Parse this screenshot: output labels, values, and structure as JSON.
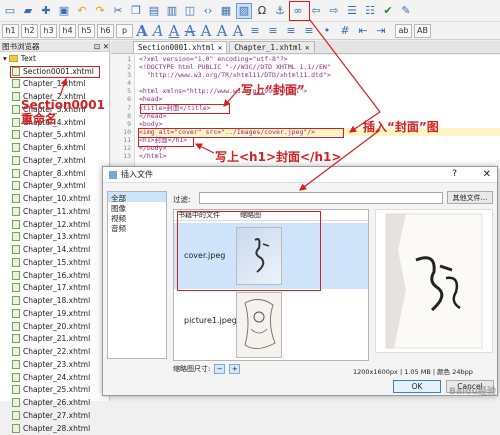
{
  "toolbar": {
    "icons": [
      "new-file",
      "open-folder",
      "add-file",
      "save",
      "undo",
      "redo",
      "cut",
      "copy",
      "paste",
      "paste-special",
      "book-view",
      "code-view",
      "insert-image",
      "omega",
      "anchor",
      "link",
      "spellcheck",
      "tidy"
    ],
    "headings": [
      "h1",
      "h2",
      "h3",
      "h4",
      "h5",
      "h6",
      "p"
    ],
    "format_glyphs": [
      "A",
      "A",
      "A",
      "A",
      "A",
      "A",
      "A"
    ],
    "right_labels": [
      "ab",
      "AB"
    ]
  },
  "browser": {
    "title": "图书浏览器",
    "pin": "⊡ ✕",
    "folder": "Text",
    "items": [
      "Section0001.xhtml",
      "Chapter_1.xhtml",
      "Chapter_2.xhtml",
      "Chapter_3.xhtml",
      "Chapter_4.xhtml",
      "Chapter_5.xhtml",
      "Chapter_6.xhtml",
      "Chapter_7.xhtml",
      "Chapter_8.xhtml",
      "Chapter_9.xhtml",
      "Chapter_10.xhtml",
      "Chapter_11.xhtml",
      "Chapter_12.xhtml",
      "Chapter_13.xhtml",
      "Chapter_14.xhtml",
      "Chapter_15.xhtml",
      "Chapter_16.xhtml",
      "Chapter_17.xhtml",
      "Chapter_18.xhtml",
      "Chapter_19.xhtml",
      "Chapter_20.xhtml",
      "Chapter_21.xhtml",
      "Chapter_22.xhtml",
      "Chapter_23.xhtml",
      "Chapter_24.xhtml",
      "Chapter_25.xhtml",
      "Chapter_26.xhtml",
      "Chapter_27.xhtml",
      "Chapter_28.xhtml"
    ]
  },
  "tabs": [
    {
      "label": "Section0001.xhtml",
      "close": "✕"
    },
    {
      "label": "Chapter_1.xhtml",
      "close": "✕"
    }
  ],
  "editor": {
    "lines": [
      "<?xml version=\"1.0\" encoding=\"utf-8\"?>",
      "<!DOCTYPE html PUBLIC \"-//W3C//DTD XHTML 1.1//EN\"",
      "  \"http://www.w3.org/TR/xhtml11/DTD/xhtml11.dtd\">",
      "",
      "<html xmlns=\"http://www.w3.org/1999/xhtml\">",
      "<head>",
      "<title>封面</title>",
      "</head>",
      "<body>",
      "<img alt=\"cover\" src=\"../Images/cover.jpeg\"/>",
      "<h1>封面</h1>",
      "</body>",
      "</html>"
    ]
  },
  "annotations": {
    "rename": "Section0001\n重命名",
    "title": "写上“封面”",
    "insert": "插入“封面”图",
    "h1": "写上<h1>封面</h1>"
  },
  "dialog": {
    "title": "插入文件",
    "help": "?",
    "close": "✕",
    "categories": [
      "全部",
      "图像",
      "视频",
      "音频"
    ],
    "filter_label": "过滤:",
    "filter_value": "",
    "other_files": "其他文件...",
    "col_files": "书籍中的文件",
    "col_thumb": "缩略图",
    "files": [
      "cover.jpeg",
      "picture1.jpeg"
    ],
    "thumb_size_label": "缩略图尺寸:",
    "thumb_minus": "−",
    "thumb_plus": "+",
    "dimensions": "1200x1600px | 1.05 MB | 颜色 24bpp",
    "ok": "OK",
    "cancel": "Cancel"
  },
  "watermark": "Baidu经验",
  "colors": {
    "annotation": "#d42020",
    "selection": "#cfe4fb"
  }
}
